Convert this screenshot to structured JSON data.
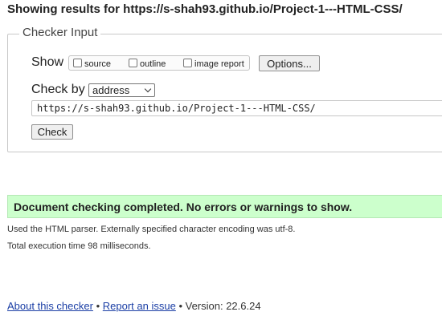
{
  "heading": "Showing results for https://s-shah93.github.io/Project-1---HTML-CSS/",
  "checker_input": {
    "legend": "Checker Input",
    "show_label": "Show",
    "options": [
      {
        "label": "source",
        "checked": false
      },
      {
        "label": "outline",
        "checked": false
      },
      {
        "label": "image report",
        "checked": false
      }
    ],
    "options_button": "Options...",
    "check_by_label": "Check by",
    "check_by_value": "address",
    "url_value": "https://s-shah93.github.io/Project-1---HTML-CSS/",
    "check_button": "Check"
  },
  "results": {
    "success_message": "Document checking completed. No errors or warnings to show.",
    "parser_info": "Used the HTML parser. Externally specified character encoding was utf-8.",
    "execution_time": "Total execution time 98 milliseconds."
  },
  "footer": {
    "about_link": "About this checker",
    "separator": "•",
    "report_link": "Report an issue",
    "version_text": "• Version: 22.6.24"
  },
  "colors": {
    "success_background": "#ccffcc",
    "link": "#1a3ea5"
  }
}
